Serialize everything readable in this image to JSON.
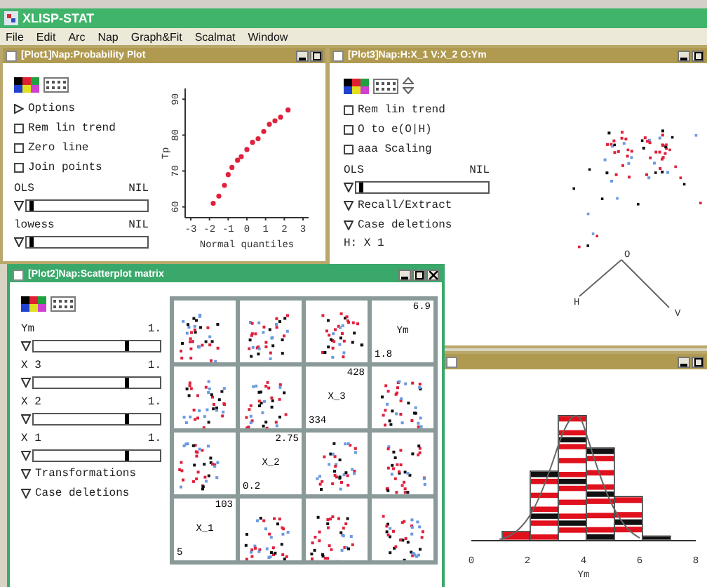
{
  "app": {
    "title": "XLISP-STAT"
  },
  "menu": [
    "File",
    "Edit",
    "Arc",
    "Nap",
    "Graph&Fit",
    "Scalmat",
    "Window"
  ],
  "prob_window": {
    "title": "[Plot1]Nap:Probability Plot",
    "active": false,
    "controls": [
      {
        "kind": "disclosure",
        "label": "Options",
        "expanded": false
      },
      {
        "kind": "checkbox",
        "label": "Rem lin trend",
        "checked": false
      },
      {
        "kind": "checkbox",
        "label": "Zero line",
        "checked": false
      },
      {
        "kind": "checkbox",
        "label": "Join points",
        "checked": false
      },
      {
        "kind": "slider",
        "label": "OLS",
        "reading": "NIL",
        "level": 0.02
      },
      {
        "kind": "slider",
        "label": "lowess",
        "reading": "NIL",
        "level": 0.02
      }
    ],
    "chart_data": {
      "type": "scatter",
      "xlabel": "Normal quantiles",
      "ylabel": "Tp",
      "xlim": [
        -3.3,
        3.3
      ],
      "ylim": [
        57,
        93
      ],
      "xticks": [
        -3,
        -2,
        -1,
        0,
        1,
        2,
        3
      ],
      "yticks": [
        60,
        70,
        80,
        90
      ],
      "x": [
        -1.8,
        -1.5,
        -1.2,
        -1,
        -0.8,
        -0.5,
        -0.3,
        0,
        0.3,
        0.6,
        0.9,
        1.2,
        1.5,
        1.8,
        2.2
      ],
      "series": [
        {
          "color": "#e0203c",
          "values": [
            61,
            63,
            66,
            69,
            71,
            73,
            74,
            76,
            78,
            79,
            81,
            83,
            84,
            85,
            87
          ]
        }
      ]
    }
  },
  "spin_window": {
    "title": "[Plot3]Nap:H:X_1 V:X_2 O:Ym",
    "active": false,
    "controls": [
      {
        "kind": "checkbox",
        "label": "Rem lin trend",
        "checked": false
      },
      {
        "kind": "checkbox",
        "label": "O to e(O|H)",
        "checked": false
      },
      {
        "kind": "checkbox",
        "label": "aaa Scaling",
        "checked": false
      },
      {
        "kind": "slider",
        "label": "OLS",
        "reading": "NIL",
        "level": 0.02
      },
      {
        "kind": "disclosure",
        "label": "Recall/Extract",
        "expanded": true
      },
      {
        "kind": "disclosure",
        "label": "Case deletions",
        "expanded": true
      },
      {
        "kind": "text",
        "label": "H: X 1"
      }
    ],
    "axes": [
      "O",
      "H",
      "V"
    ]
  },
  "matrix_window": {
    "title": "[Plot2]Nap:Scatterplot matrix",
    "active": true,
    "controls": [
      {
        "kind": "slider",
        "label": "Ym",
        "reading": "1.",
        "level": 0.72
      },
      {
        "kind": "slider",
        "label": "X 3",
        "reading": "1.",
        "level": 0.72
      },
      {
        "kind": "slider",
        "label": "X 2",
        "reading": "1.",
        "level": 0.72
      },
      {
        "kind": "slider",
        "label": "X 1",
        "reading": "1.",
        "level": 0.72
      },
      {
        "kind": "disclosure",
        "label": "Transformations",
        "expanded": true
      },
      {
        "kind": "disclosure",
        "label": "Case deletions",
        "expanded": true
      }
    ],
    "variables": [
      {
        "name": "Ym",
        "max": "6.9",
        "min": "1.8"
      },
      {
        "name": "X_3",
        "max": "428",
        "min": "334"
      },
      {
        "name": "X_2",
        "max": "2.75",
        "min": "0.2"
      },
      {
        "name": "X_1",
        "max": "103",
        "min": "5"
      }
    ]
  },
  "hist_window": {
    "active": false,
    "xticks": [
      "0",
      "2",
      "4",
      "6",
      "8"
    ],
    "xlabel": "Ym"
  }
}
